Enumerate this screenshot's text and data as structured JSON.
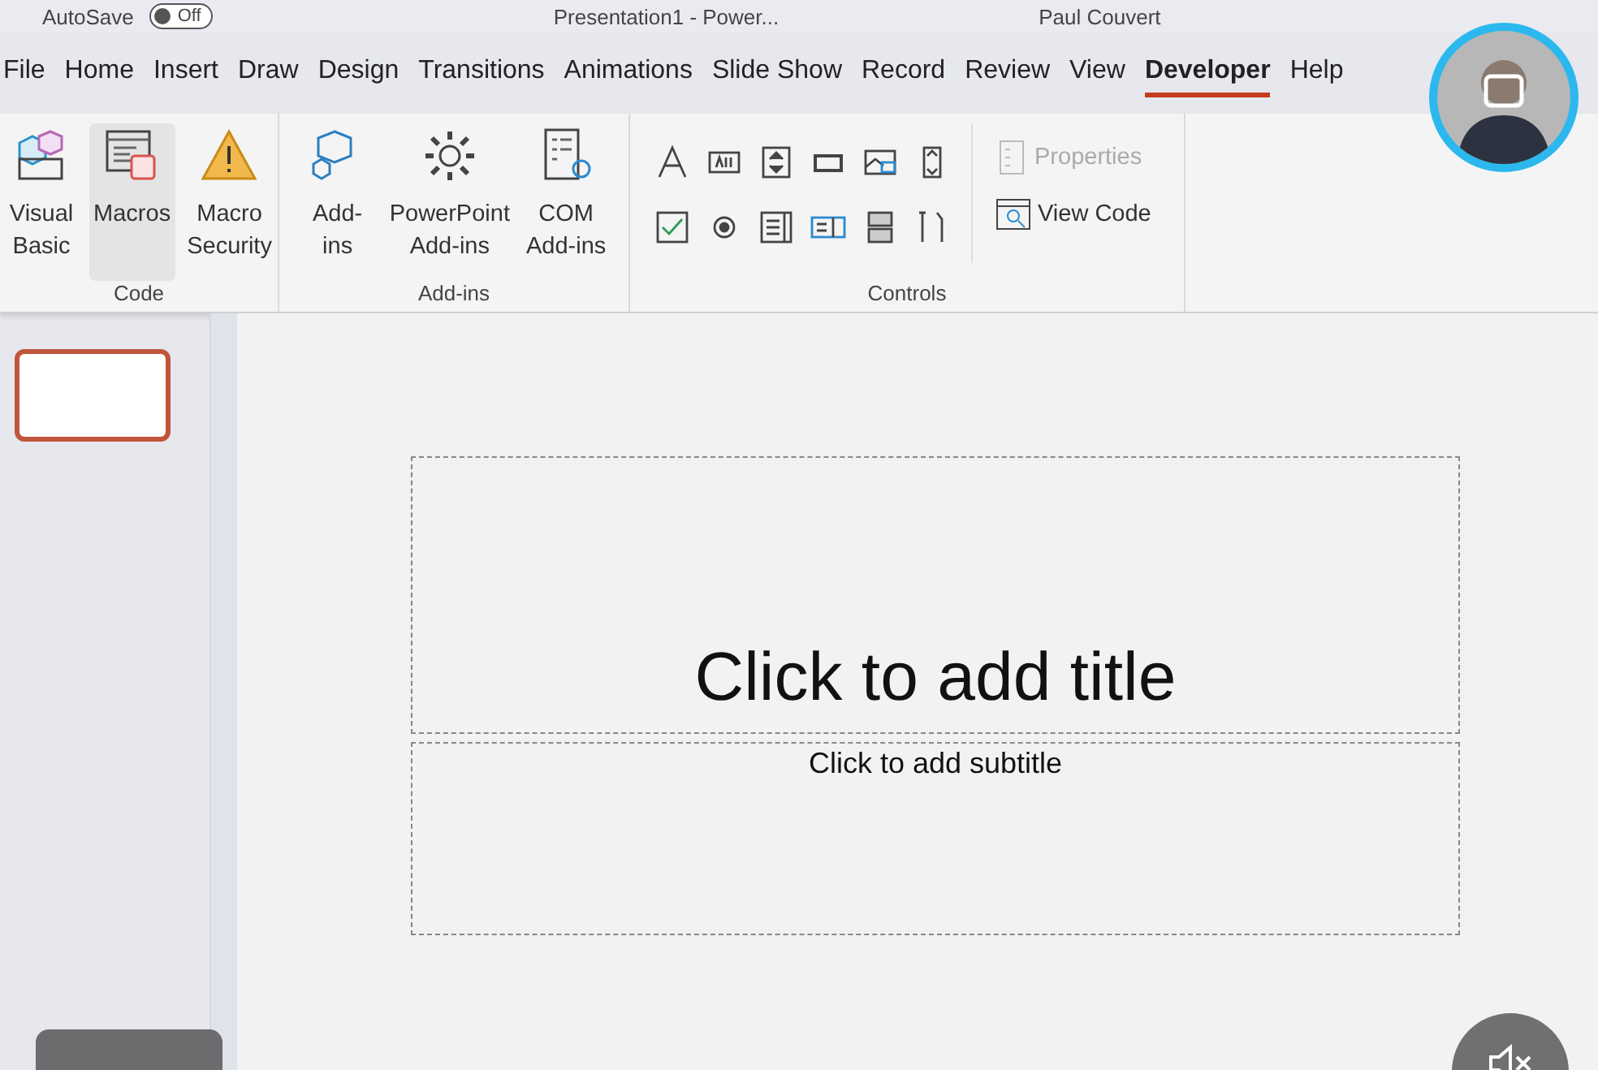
{
  "title_bar": {
    "autosave_label": "AutoSave",
    "autosave_toggle": {
      "label": "Off",
      "on": false
    },
    "document_title": "Presentation1  -  Power...",
    "user_name": "Paul Couvert"
  },
  "tabs": [
    {
      "label": "File",
      "selected": false
    },
    {
      "label": "Home",
      "selected": false
    },
    {
      "label": "Insert",
      "selected": false
    },
    {
      "label": "Draw",
      "selected": false
    },
    {
      "label": "Design",
      "selected": false
    },
    {
      "label": "Transitions",
      "selected": false
    },
    {
      "label": "Animations",
      "selected": false
    },
    {
      "label": "Slide Show",
      "selected": false
    },
    {
      "label": "Record",
      "selected": false
    },
    {
      "label": "Review",
      "selected": false
    },
    {
      "label": "View",
      "selected": false
    },
    {
      "label": "Developer",
      "selected": true
    },
    {
      "label": "Help",
      "selected": false
    }
  ],
  "ribbon": {
    "groups": [
      {
        "label": "Code",
        "kind": "large",
        "buttons": [
          {
            "lines": [
              "Visual",
              "Basic"
            ],
            "hovered": false
          },
          {
            "lines": [
              "Macros"
            ],
            "hovered": true
          },
          {
            "lines": [
              "Macro",
              "Security"
            ],
            "hovered": false
          }
        ]
      },
      {
        "label": "Add-ins",
        "kind": "large",
        "buttons": [
          {
            "lines": [
              "Add-",
              "ins"
            ],
            "hovered": false
          },
          {
            "lines": [
              "PowerPoint",
              "Add-ins"
            ],
            "hovered": false
          },
          {
            "lines": [
              "COM",
              "Add-ins"
            ],
            "hovered": false
          }
        ]
      },
      {
        "label": "Controls",
        "kind": "controls",
        "tools": [
          {
            "kind": "label"
          },
          {
            "kind": "textbox"
          },
          {
            "kind": "spin"
          },
          {
            "kind": "button"
          },
          {
            "kind": "image"
          },
          {
            "kind": "scroll"
          },
          {
            "kind": "checkbox"
          },
          {
            "kind": "radio"
          },
          {
            "kind": "listbox"
          },
          {
            "kind": "combo"
          },
          {
            "kind": "toggle"
          },
          {
            "kind": "more"
          }
        ],
        "buttons": [
          {
            "label": "Properties",
            "disabled": true
          },
          {
            "label": "View Code",
            "disabled": false
          }
        ]
      }
    ]
  },
  "slides": [
    {
      "selected": true
    }
  ],
  "slide": {
    "title_placeholder": "Click to add title",
    "subtitle_placeholder": "Click to add subtitle"
  },
  "video": {
    "muted": true
  }
}
